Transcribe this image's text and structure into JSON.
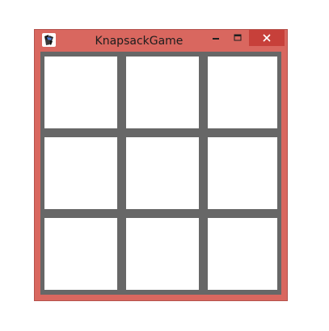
{
  "window": {
    "title": "KnapsackGame",
    "app_icon": "app-icon",
    "controls": {
      "minimize_icon": "minimize-icon",
      "maximize_icon": "maximize-icon",
      "close_icon": "close-icon"
    },
    "colors": {
      "frame": "#d9675f",
      "close_button": "#c7403a",
      "grid": "#676767",
      "cell": "#ffffff"
    }
  },
  "board": {
    "rows": 3,
    "cols": 3,
    "cells": [
      [
        "",
        "",
        ""
      ],
      [
        "",
        "",
        ""
      ],
      [
        "",
        "",
        ""
      ]
    ]
  }
}
